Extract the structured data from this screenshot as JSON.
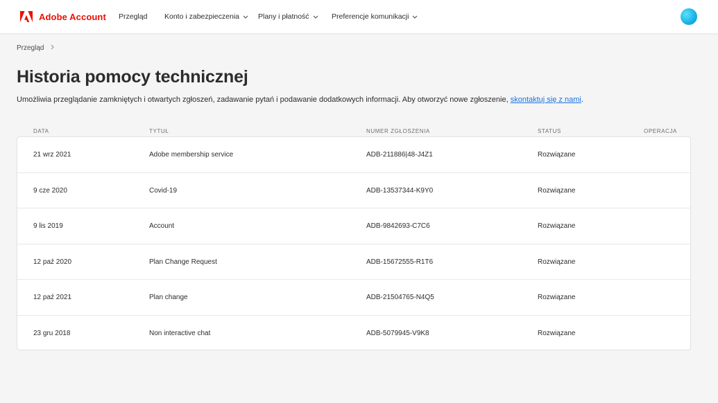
{
  "brand": {
    "name": "Adobe Account",
    "logo_color": "#eb1000"
  },
  "nav": {
    "items": [
      {
        "label": "Przegląd",
        "has_dropdown": false
      },
      {
        "label": "Konto i zabezpieczenia",
        "has_dropdown": true
      },
      {
        "label": "Plany i płatność",
        "has_dropdown": true
      },
      {
        "label": "Preferencje komunikacji",
        "has_dropdown": true
      }
    ]
  },
  "breadcrumb": {
    "items": [
      "Przegląd"
    ]
  },
  "page": {
    "title": "Historia pomocy technicznej",
    "subtitle_text": "Umożliwia przeglądanie zamkniętych i otwartych zgłoszeń, zadawanie pytań i podawanie dodatkowych informacji. Aby otworzyć nowe zgłoszenie, ",
    "subtitle_link": "skontaktuj się z nami",
    "subtitle_end": ".",
    "link_color": "#1473e6"
  },
  "table": {
    "columns": [
      "DATA",
      "TYTUŁ",
      "NUMER ZGŁOSZENIA",
      "STATUS",
      "OPERACJA"
    ],
    "rows": [
      {
        "date": "21 wrz 2021",
        "title": "Adobe membership service",
        "ticket": "ADB-211886|48-J4Z1",
        "status": "Rozwiązane"
      },
      {
        "date": "9 cze 2020",
        "title": "Covid-19",
        "ticket": "ADB-13537344-K9Y0",
        "status": "Rozwiązane"
      },
      {
        "date": "9 lis 2019",
        "title": "Account",
        "ticket": "ADB-9842693-C7C6",
        "status": "Rozwiązane"
      },
      {
        "date": "12 paź 2020",
        "title": "Plan Change Request",
        "ticket": "ADB-15672555-R1T6",
        "status": "Rozwiązane"
      },
      {
        "date": "12 paź 2021",
        "title": "Plan change",
        "ticket": "ADB-21504765-N4Q5",
        "status": "Rozwiązane"
      },
      {
        "date": "23 gru 2018",
        "title": "Non interactive chat",
        "ticket": "ADB-5079945-V9K8",
        "status": "Rozwiązane"
      }
    ]
  }
}
